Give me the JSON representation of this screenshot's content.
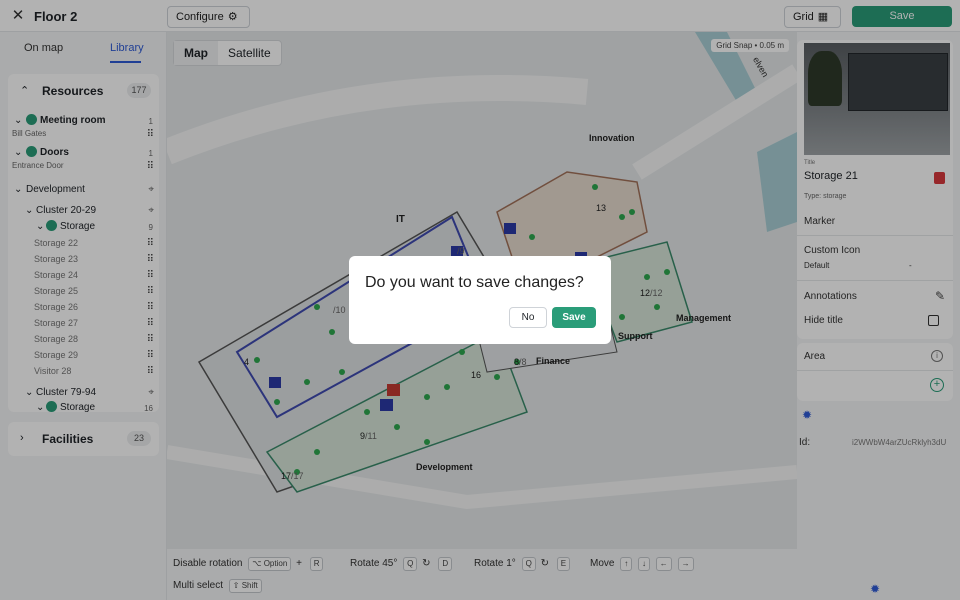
{
  "topbar": {
    "title": "Floor 2",
    "configure_label": "Configure",
    "grid_label": "Grid",
    "save_label": "Save"
  },
  "sidebar": {
    "tabs": [
      "On map",
      "Library"
    ],
    "active_tab": "Library",
    "resources": {
      "title": "Resources",
      "count": "177",
      "items": [
        {
          "label": "Meeting room",
          "count": "1",
          "sub": "Bill Gates"
        },
        {
          "label": "Doors",
          "count": "1",
          "sub": "Entrance Door"
        },
        {
          "label": "Development"
        },
        {
          "label": "Cluster 20-29"
        },
        {
          "label": "Storage",
          "count": "9"
        },
        {
          "label": "Storage 22"
        },
        {
          "label": "Storage 23"
        },
        {
          "label": "Storage 24"
        },
        {
          "label": "Storage 25"
        },
        {
          "label": "Storage 26"
        },
        {
          "label": "Storage 27"
        },
        {
          "label": "Storage 28"
        },
        {
          "label": "Storage 29"
        },
        {
          "label": "Visitor 28"
        },
        {
          "label": "Cluster 79-94"
        },
        {
          "label": "Storage",
          "count": "16"
        }
      ]
    },
    "facilities": {
      "title": "Facilities",
      "count": "23"
    }
  },
  "map": {
    "tabs": [
      "Map",
      "Satellite"
    ],
    "active": "Map",
    "grid_snap": "Grid Snap • 0.05 m",
    "area_labels": [
      "Innovation",
      "IT",
      "Management",
      "Support",
      "Finance",
      "Development"
    ],
    "street_label": "elven",
    "cluster_counts": [
      {
        "n": "13",
        "d": ""
      },
      {
        "n": "12",
        "d": "/12"
      },
      {
        "n": "",
        "d": "/10"
      },
      {
        "n": "4",
        "d": ""
      },
      {
        "n": "16",
        "d": ""
      },
      {
        "n": "8",
        "d": "/8"
      },
      {
        "n": "9",
        "d": "/11"
      },
      {
        "n": "17",
        "d": "/17"
      },
      {
        "n": "",
        "d": "/9"
      }
    ]
  },
  "shortcuts": {
    "disable_rotation": "Disable rotation",
    "option_key": "⌥ Option",
    "plus": "+",
    "r_key": "R",
    "rotate45": "Rotate 45°",
    "q_key": "Q",
    "d_key": "D",
    "rotate1": "Rotate 1°",
    "e_key": "E",
    "move": "Move",
    "arrows": [
      "↑",
      "↓",
      "←",
      "→"
    ],
    "multi_select": "Multi select",
    "shift_key": "⇧ Shift"
  },
  "rpanel": {
    "title_label": "Title",
    "title_value": "Storage 21",
    "type_line": "Type: storage",
    "marker": "Marker",
    "custom_icon": "Custom Icon",
    "custom_icon_value": "Default",
    "custom_icon_dash": "-",
    "annotations": "Annotations",
    "hide_title": "Hide title",
    "area": "Area",
    "id_label": "Id:",
    "id_value": "i2WWbW4arZUcRklyh3dU"
  },
  "dialog": {
    "question": "Do you want to save changes?",
    "no_label": "No",
    "save_label": "Save"
  },
  "colors": {
    "brand_green": "#2a9d79",
    "link_blue": "#2f5bd6",
    "danger_red": "#d9393d"
  }
}
